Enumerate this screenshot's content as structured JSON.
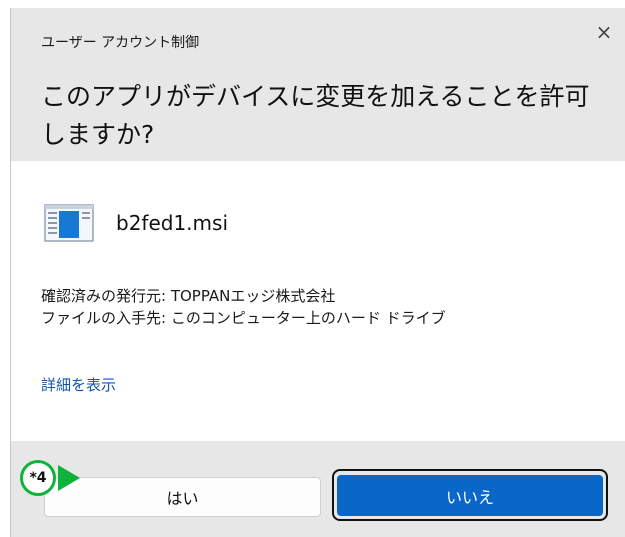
{
  "dialog": {
    "window_title": "ユーザー アカウント制御",
    "close_glyph": "×",
    "question": "このアプリがデバイスに変更を加えることを許可しますか?"
  },
  "file": {
    "name": "b2fed1.msi",
    "icon": "msi-installer-icon"
  },
  "details": {
    "publisher": "確認済みの発行元: TOPPANエッジ株式会社",
    "origin": "ファイルの入手先: このコンピューター上のハード ドライブ"
  },
  "show_details_label": "詳細を表示",
  "buttons": {
    "yes": "はい",
    "no": "いいえ"
  },
  "annotation": {
    "step_label": "*4",
    "color": "#0fb23a"
  },
  "colors": {
    "header_bg": "#e7e7e7",
    "accent": "#0a66c7",
    "link": "#1656a8"
  }
}
